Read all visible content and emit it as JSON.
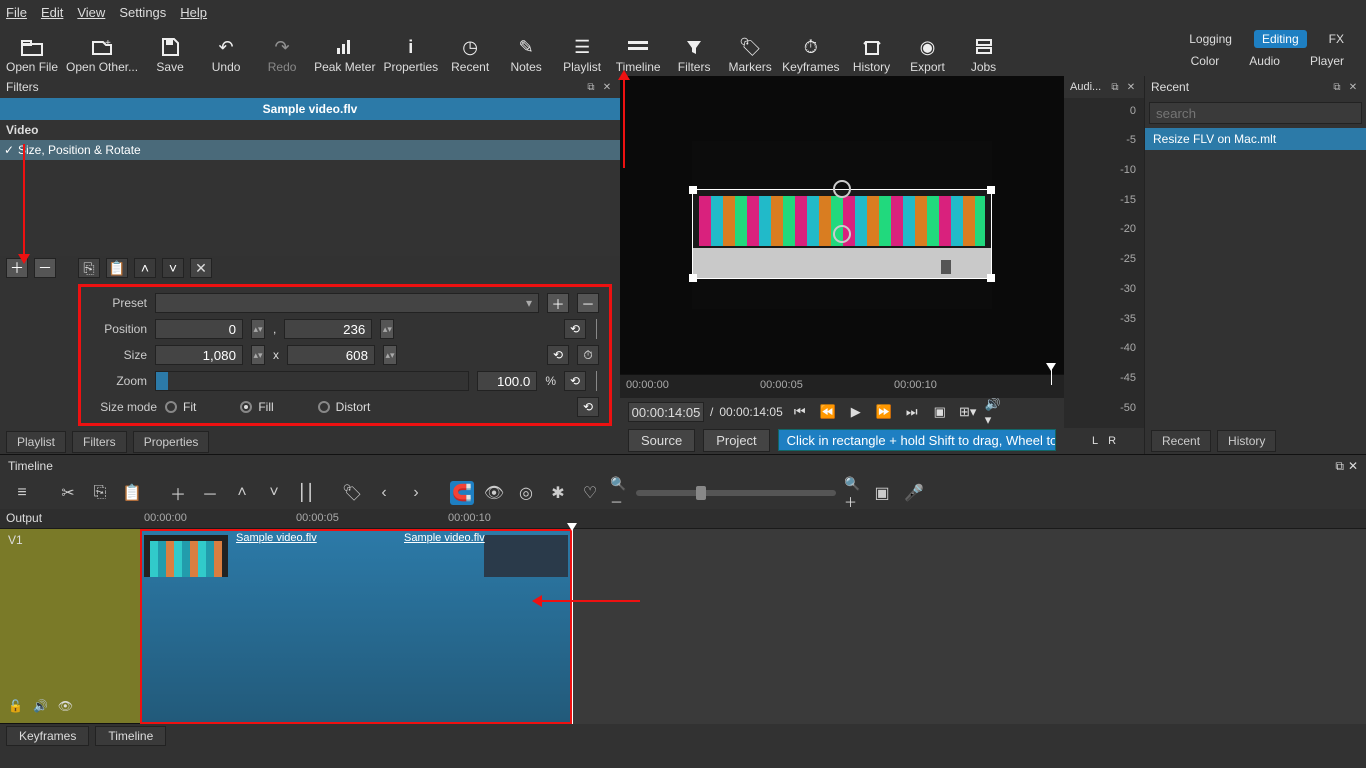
{
  "menu": {
    "file": "File",
    "edit": "Edit",
    "view": "View",
    "settings": "Settings",
    "help": "Help"
  },
  "toolbar": {
    "open_file": "Open File",
    "open_other": "Open Other...",
    "save": "Save",
    "undo": "Undo",
    "redo": "Redo",
    "peak": "Peak Meter",
    "properties": "Properties",
    "recent": "Recent",
    "notes": "Notes",
    "playlist": "Playlist",
    "timeline": "Timeline",
    "filters": "Filters",
    "markers": "Markers",
    "keyframes": "Keyframes",
    "history": "History",
    "export": "Export",
    "jobs": "Jobs"
  },
  "modes": {
    "logging": "Logging",
    "editing": "Editing",
    "fx": "FX",
    "color": "Color",
    "audio": "Audio",
    "player": "Player"
  },
  "filters": {
    "panel": "Filters",
    "clip": "Sample video.flv",
    "section": "Video",
    "item": "Size, Position & Rotate",
    "preset": "Preset",
    "position": "Position",
    "posx": "0",
    "posy": "236",
    "size": "Size",
    "sizew": "1,080",
    "sizeh": "608",
    "zoom": "Zoom",
    "zoomval": "100.0",
    "pct": "%",
    "sizemode": "Size mode",
    "fit": "Fit",
    "fill": "Fill",
    "distort": "Distort",
    "sep_x": "x",
    "sep_c": ","
  },
  "left_tabs": {
    "playlist": "Playlist",
    "filters": "Filters",
    "properties": "Properties"
  },
  "preview": {
    "r0": "00:00:00",
    "r5": "00:00:05",
    "r10": "00:00:10",
    "tc": "00:00:14:05",
    "div": "/",
    "dur": "00:00:14:05"
  },
  "srcproj": {
    "source": "Source",
    "project": "Project",
    "hint": "Click in rectangle + hold Shift to drag, Wheel to zoom,..."
  },
  "audio": {
    "panel": "Audi...",
    "zero": "0",
    "m5": "-5",
    "m10": "-10",
    "m15": "-15",
    "m20": "-20",
    "m25": "-25",
    "m30": "-30",
    "m35": "-35",
    "m40": "-40",
    "m45": "-45",
    "m50": "-50",
    "lr_l": "L",
    "lr_r": "R"
  },
  "recent": {
    "panel": "Recent",
    "search": "search",
    "item": "Resize FLV on Mac.mlt",
    "tab_recent": "Recent",
    "tab_history": "History"
  },
  "timeline": {
    "panel": "Timeline",
    "output": "Output",
    "track": "V1",
    "r0": "00:00:00",
    "r5": "00:00:05",
    "r10": "00:00:10",
    "clip1": "Sample video.flv",
    "clip2": "Sample video.flv"
  },
  "bottom_tabs": {
    "keyframes": "Keyframes",
    "timeline": "Timeline"
  }
}
